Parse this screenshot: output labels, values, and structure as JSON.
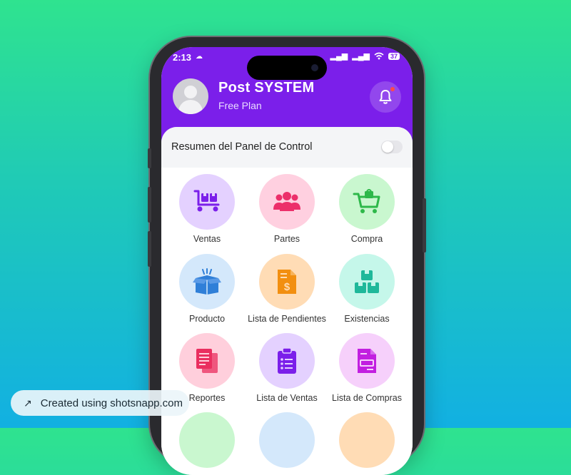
{
  "status_bar": {
    "time": "2:13",
    "battery": "37"
  },
  "header": {
    "title": "Post SYSTEM",
    "subtitle": "Free Plan",
    "bg_color": "#7b1fea"
  },
  "summary": {
    "label": "Resumen del Panel de Control",
    "toggle_on": false
  },
  "menu": [
    {
      "label": "Ventas",
      "icon": "dolly-boxes-icon",
      "circle": "#e4d1ff",
      "color": "#7b1fea"
    },
    {
      "label": "Partes",
      "icon": "users-group-icon",
      "circle": "#ffd0e0",
      "color": "#ec2f6a"
    },
    {
      "label": "Compra",
      "icon": "shopping-cart-icon",
      "circle": "#c9f7cf",
      "color": "#2eb84a"
    },
    {
      "label": "Producto",
      "icon": "open-box-icon",
      "circle": "#d4e8fb",
      "color": "#2f7fd8"
    },
    {
      "label": "Lista de Pendientes",
      "icon": "invoice-dollar-icon",
      "circle": "#ffdcb5",
      "color": "#f28f10"
    },
    {
      "label": "Existencias",
      "icon": "stacked-boxes-icon",
      "circle": "#c5f7ea",
      "color": "#1fb89a"
    },
    {
      "label": "Reportes",
      "icon": "documents-icon",
      "circle": "#ffcfdc",
      "color": "#ea2e5f"
    },
    {
      "label": "Lista de Ventas",
      "icon": "clipboard-list-icon",
      "circle": "#e4d1ff",
      "color": "#7b1fea"
    },
    {
      "label": "Lista de Compras",
      "icon": "file-invoice-icon",
      "circle": "#f6d0fb",
      "color": "#c21fe0"
    }
  ],
  "watermark": {
    "text": "Created using shotsnapp.com"
  }
}
